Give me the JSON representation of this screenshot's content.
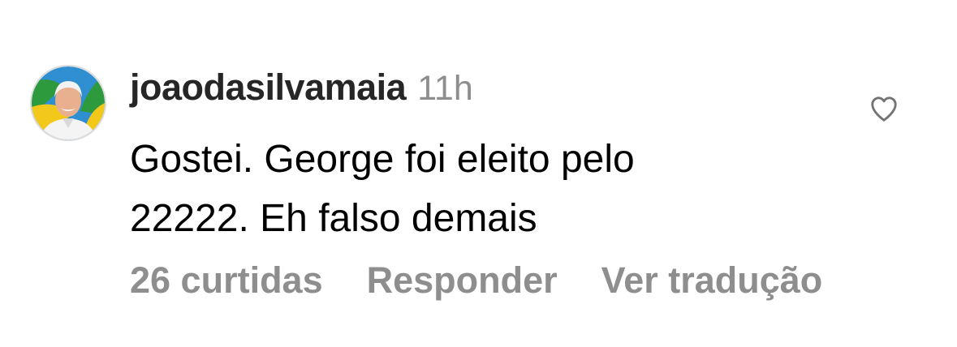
{
  "comment": {
    "username": "joaodasilvamaia",
    "time_ago": "11h",
    "text_line1": "Gostei. George foi eleito pelo",
    "text_line2": "22222. Eh falso demais",
    "avatar_icon": "profile-photo",
    "like_icon": "heart-outline-icon"
  },
  "actions": {
    "likes": "26 curtidas",
    "reply": "Responder",
    "translate": "Ver tradução"
  },
  "colors": {
    "username": "#262626",
    "secondary": "#8e8e8e",
    "text": "#000000",
    "avatar_border": "#dbdbdb"
  }
}
